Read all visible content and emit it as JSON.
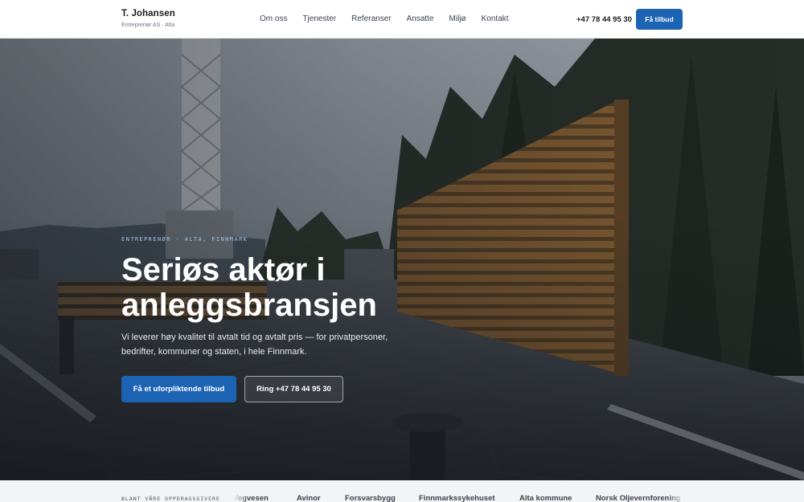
{
  "header": {
    "brand_name": "T. Johansen",
    "brand_sub": "Entreprenør AS · Alta",
    "nav": [
      "Om oss",
      "Tjenester",
      "Referanser",
      "Ansatte",
      "Miljø",
      "Kontakt"
    ],
    "phone": "+47 78 44 95 30",
    "cta_label": "Få tilbud"
  },
  "hero": {
    "eyebrow": "ENTREPRENØR · ALTA, FINNMARK",
    "title": "Seriøs aktør i anleggsbransjen",
    "text": "Vi leverer høy kvalitet til avtalt tid og avtalt pris — for privatpersoner, bedrifter, kommuner og staten, i hele Finnmark.",
    "primary_button": "Få et uforpliktende tilbud",
    "secondary_button": "Ring +47 78 44 95 30"
  },
  "clients": {
    "label": "BLANT VÅRE OPPDRAGSGIVERE",
    "items": [
      "Vegvesen",
      "Avinor",
      "Forsvarsbygg",
      "Finnmarkssykehuset",
      "Alta kommune",
      "Norsk Oljevernforening"
    ]
  },
  "colors": {
    "accent": "#1d63b4",
    "header_bg": "#ffffff",
    "strip_bg": "#f3f4f6",
    "eyebrow": "#9ec3ea"
  }
}
